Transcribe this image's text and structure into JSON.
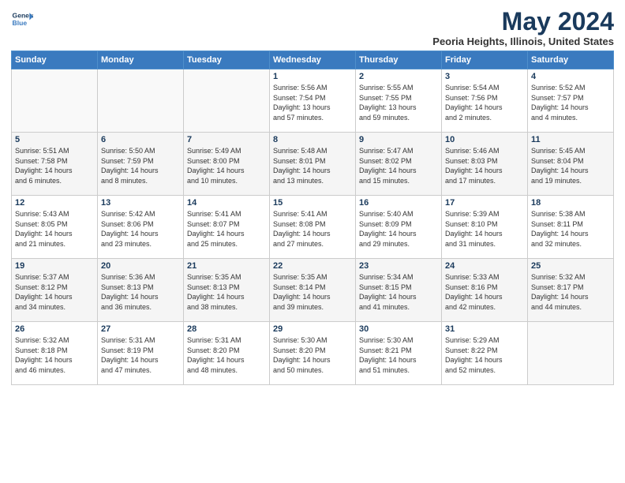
{
  "logo": {
    "line1": "General",
    "line2": "Blue"
  },
  "title": "May 2024",
  "subtitle": "Peoria Heights, Illinois, United States",
  "days_header": [
    "Sunday",
    "Monday",
    "Tuesday",
    "Wednesday",
    "Thursday",
    "Friday",
    "Saturday"
  ],
  "weeks": [
    [
      {
        "num": "",
        "info": ""
      },
      {
        "num": "",
        "info": ""
      },
      {
        "num": "",
        "info": ""
      },
      {
        "num": "1",
        "info": "Sunrise: 5:56 AM\nSunset: 7:54 PM\nDaylight: 13 hours\nand 57 minutes."
      },
      {
        "num": "2",
        "info": "Sunrise: 5:55 AM\nSunset: 7:55 PM\nDaylight: 13 hours\nand 59 minutes."
      },
      {
        "num": "3",
        "info": "Sunrise: 5:54 AM\nSunset: 7:56 PM\nDaylight: 14 hours\nand 2 minutes."
      },
      {
        "num": "4",
        "info": "Sunrise: 5:52 AM\nSunset: 7:57 PM\nDaylight: 14 hours\nand 4 minutes."
      }
    ],
    [
      {
        "num": "5",
        "info": "Sunrise: 5:51 AM\nSunset: 7:58 PM\nDaylight: 14 hours\nand 6 minutes."
      },
      {
        "num": "6",
        "info": "Sunrise: 5:50 AM\nSunset: 7:59 PM\nDaylight: 14 hours\nand 8 minutes."
      },
      {
        "num": "7",
        "info": "Sunrise: 5:49 AM\nSunset: 8:00 PM\nDaylight: 14 hours\nand 10 minutes."
      },
      {
        "num": "8",
        "info": "Sunrise: 5:48 AM\nSunset: 8:01 PM\nDaylight: 14 hours\nand 13 minutes."
      },
      {
        "num": "9",
        "info": "Sunrise: 5:47 AM\nSunset: 8:02 PM\nDaylight: 14 hours\nand 15 minutes."
      },
      {
        "num": "10",
        "info": "Sunrise: 5:46 AM\nSunset: 8:03 PM\nDaylight: 14 hours\nand 17 minutes."
      },
      {
        "num": "11",
        "info": "Sunrise: 5:45 AM\nSunset: 8:04 PM\nDaylight: 14 hours\nand 19 minutes."
      }
    ],
    [
      {
        "num": "12",
        "info": "Sunrise: 5:43 AM\nSunset: 8:05 PM\nDaylight: 14 hours\nand 21 minutes."
      },
      {
        "num": "13",
        "info": "Sunrise: 5:42 AM\nSunset: 8:06 PM\nDaylight: 14 hours\nand 23 minutes."
      },
      {
        "num": "14",
        "info": "Sunrise: 5:41 AM\nSunset: 8:07 PM\nDaylight: 14 hours\nand 25 minutes."
      },
      {
        "num": "15",
        "info": "Sunrise: 5:41 AM\nSunset: 8:08 PM\nDaylight: 14 hours\nand 27 minutes."
      },
      {
        "num": "16",
        "info": "Sunrise: 5:40 AM\nSunset: 8:09 PM\nDaylight: 14 hours\nand 29 minutes."
      },
      {
        "num": "17",
        "info": "Sunrise: 5:39 AM\nSunset: 8:10 PM\nDaylight: 14 hours\nand 31 minutes."
      },
      {
        "num": "18",
        "info": "Sunrise: 5:38 AM\nSunset: 8:11 PM\nDaylight: 14 hours\nand 32 minutes."
      }
    ],
    [
      {
        "num": "19",
        "info": "Sunrise: 5:37 AM\nSunset: 8:12 PM\nDaylight: 14 hours\nand 34 minutes."
      },
      {
        "num": "20",
        "info": "Sunrise: 5:36 AM\nSunset: 8:13 PM\nDaylight: 14 hours\nand 36 minutes."
      },
      {
        "num": "21",
        "info": "Sunrise: 5:35 AM\nSunset: 8:13 PM\nDaylight: 14 hours\nand 38 minutes."
      },
      {
        "num": "22",
        "info": "Sunrise: 5:35 AM\nSunset: 8:14 PM\nDaylight: 14 hours\nand 39 minutes."
      },
      {
        "num": "23",
        "info": "Sunrise: 5:34 AM\nSunset: 8:15 PM\nDaylight: 14 hours\nand 41 minutes."
      },
      {
        "num": "24",
        "info": "Sunrise: 5:33 AM\nSunset: 8:16 PM\nDaylight: 14 hours\nand 42 minutes."
      },
      {
        "num": "25",
        "info": "Sunrise: 5:32 AM\nSunset: 8:17 PM\nDaylight: 14 hours\nand 44 minutes."
      }
    ],
    [
      {
        "num": "26",
        "info": "Sunrise: 5:32 AM\nSunset: 8:18 PM\nDaylight: 14 hours\nand 46 minutes."
      },
      {
        "num": "27",
        "info": "Sunrise: 5:31 AM\nSunset: 8:19 PM\nDaylight: 14 hours\nand 47 minutes."
      },
      {
        "num": "28",
        "info": "Sunrise: 5:31 AM\nSunset: 8:20 PM\nDaylight: 14 hours\nand 48 minutes."
      },
      {
        "num": "29",
        "info": "Sunrise: 5:30 AM\nSunset: 8:20 PM\nDaylight: 14 hours\nand 50 minutes."
      },
      {
        "num": "30",
        "info": "Sunrise: 5:30 AM\nSunset: 8:21 PM\nDaylight: 14 hours\nand 51 minutes."
      },
      {
        "num": "31",
        "info": "Sunrise: 5:29 AM\nSunset: 8:22 PM\nDaylight: 14 hours\nand 52 minutes."
      },
      {
        "num": "",
        "info": ""
      }
    ]
  ]
}
